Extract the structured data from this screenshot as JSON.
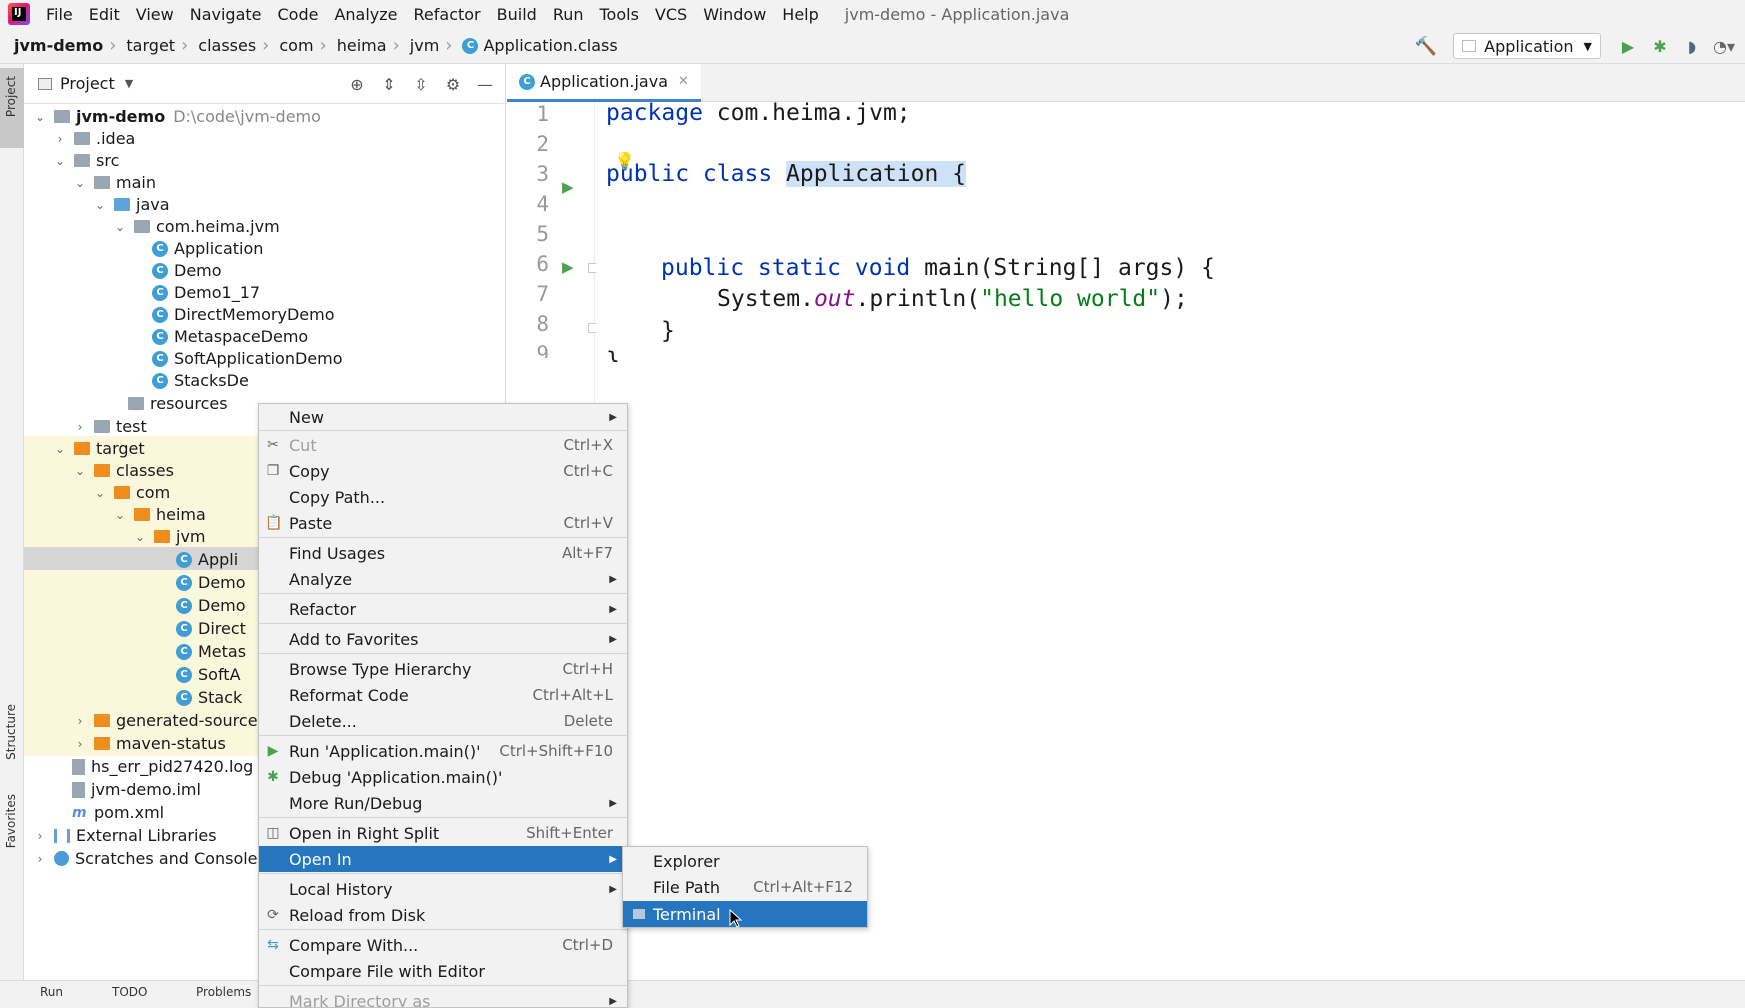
{
  "menubar": {
    "items": [
      "File",
      "Edit",
      "View",
      "Navigate",
      "Code",
      "Analyze",
      "Refactor",
      "Build",
      "Run",
      "Tools",
      "VCS",
      "Window",
      "Help"
    ],
    "window_title": "jvm-demo - Application.java"
  },
  "navbar": {
    "breadcrumbs": [
      "jvm-demo",
      "target",
      "classes",
      "com",
      "heima",
      "jvm",
      "Application.class"
    ],
    "run_config": "Application"
  },
  "left_strip": {
    "project_label": "Project",
    "structure_label": "Structure",
    "favorites_label": "Favorites"
  },
  "project_panel": {
    "title": "Project",
    "tree": [
      {
        "label": "jvm-demo",
        "suffix": "D:\\code\\jvm-demo"
      },
      {
        "label": ".idea"
      },
      {
        "label": "src"
      },
      {
        "label": "main"
      },
      {
        "label": "java"
      },
      {
        "label": "com.heima.jvm"
      },
      {
        "label": "Application"
      },
      {
        "label": "Demo"
      },
      {
        "label": "Demo1_17"
      },
      {
        "label": "DirectMemoryDemo"
      },
      {
        "label": "MetaspaceDemo"
      },
      {
        "label": "SoftApplicationDemo"
      },
      {
        "label": "StacksDe"
      },
      {
        "label": "resources"
      },
      {
        "label": "test"
      },
      {
        "label": "target"
      },
      {
        "label": "classes"
      },
      {
        "label": "com"
      },
      {
        "label": "heima"
      },
      {
        "label": "jvm"
      },
      {
        "label": "Appli"
      },
      {
        "label": "Demo"
      },
      {
        "label": "Demo"
      },
      {
        "label": "Direct"
      },
      {
        "label": "Metas"
      },
      {
        "label": "SoftA"
      },
      {
        "label": "Stack"
      },
      {
        "label": "generated-source"
      },
      {
        "label": "maven-status"
      },
      {
        "label": "hs_err_pid27420.log"
      },
      {
        "label": "jvm-demo.iml"
      },
      {
        "label": "pom.xml"
      },
      {
        "label": "External Libraries"
      },
      {
        "label": "Scratches and Consoles"
      }
    ]
  },
  "editor": {
    "tab_label": "Application.java",
    "line_numbers": [
      "1",
      "2",
      "3",
      "4",
      "5",
      "6",
      "7",
      "8",
      "9"
    ],
    "code": {
      "l1_kw": "package",
      "l1_rest": " com.heima.jvm;",
      "l3_kw": "public class ",
      "l3_name": "Application {",
      "l6_kw": "public static void ",
      "l6_rest": "main(String[] args) {",
      "l7_a": "System.",
      "l7_field": "out",
      "l7_b": ".println(",
      "l7_str": "\"hello world\"",
      "l7_c": ");",
      "l8": "}",
      "l9": "}"
    }
  },
  "bottom_bar": {
    "run_tab": "Run",
    "todo_tab": "TODO",
    "problems_tab": "Problems"
  },
  "context_menu": {
    "items": [
      {
        "label": "New",
        "shortcut": "",
        "submenu": true
      },
      {
        "label": "Cut",
        "shortcut": "Ctrl+X"
      },
      {
        "label": "Copy",
        "shortcut": "Ctrl+C"
      },
      {
        "label": "Copy Path...",
        "shortcut": ""
      },
      {
        "label": "Paste",
        "shortcut": "Ctrl+V"
      },
      {
        "label": "Find Usages",
        "shortcut": "Alt+F7"
      },
      {
        "label": "Analyze",
        "shortcut": "",
        "submenu": true
      },
      {
        "label": "Refactor",
        "shortcut": "",
        "submenu": true
      },
      {
        "label": "Add to Favorites",
        "shortcut": "",
        "submenu": true
      },
      {
        "label": "Browse Type Hierarchy",
        "shortcut": "Ctrl+H"
      },
      {
        "label": "Reformat Code",
        "shortcut": "Ctrl+Alt+L"
      },
      {
        "label": "Delete...",
        "shortcut": "Delete"
      },
      {
        "label": "Run 'Application.main()'",
        "shortcut": "Ctrl+Shift+F10"
      },
      {
        "label": "Debug 'Application.main()'",
        "shortcut": ""
      },
      {
        "label": "More Run/Debug",
        "shortcut": "",
        "submenu": true
      },
      {
        "label": "Open in Right Split",
        "shortcut": "Shift+Enter"
      },
      {
        "label": "Open In",
        "shortcut": "",
        "submenu": true
      },
      {
        "label": "Local History",
        "shortcut": "",
        "submenu": true
      },
      {
        "label": "Reload from Disk",
        "shortcut": ""
      },
      {
        "label": "Compare With...",
        "shortcut": "Ctrl+D"
      },
      {
        "label": "Compare File with Editor",
        "shortcut": ""
      },
      {
        "label": "Mark Directory as",
        "shortcut": "",
        "submenu": true
      }
    ]
  },
  "submenu_open_in": {
    "items": [
      {
        "label": "Explorer",
        "shortcut": ""
      },
      {
        "label": "File Path",
        "shortcut": "Ctrl+Alt+F12"
      },
      {
        "label": "Terminal",
        "shortcut": ""
      }
    ]
  },
  "colors": {
    "selection_blue": "#2675bf",
    "keyword_blue": "#0033b3",
    "string_green": "#067d17",
    "folder_orange": "#f08e1d",
    "run_green": "#4aa34a"
  }
}
